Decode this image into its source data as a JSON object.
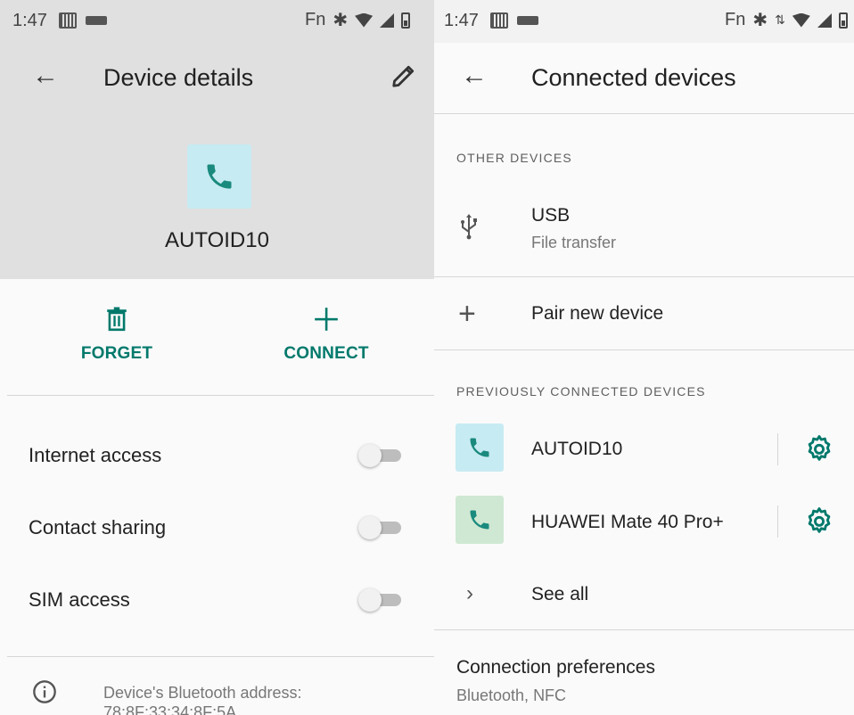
{
  "left_panel": {
    "status": {
      "time": "1:47",
      "volte": "VOLTE",
      "fn": "Fn"
    },
    "header": {
      "title": "Device details"
    },
    "device": {
      "name": "AUTOID10"
    },
    "actions": {
      "forget": "FORGET",
      "connect": "CONNECT"
    },
    "toggles": [
      {
        "label": "Internet access",
        "on": false
      },
      {
        "label": "Contact sharing",
        "on": false
      },
      {
        "label": "SIM access",
        "on": false
      }
    ],
    "bluetooth_address": {
      "label": "Device's Bluetooth address:",
      "value": "78:8F:33:34:8F:5A"
    }
  },
  "right_panel": {
    "status": {
      "time": "1:47",
      "volte": "VOLTE",
      "fn": "Fn"
    },
    "header": {
      "title": "Connected devices"
    },
    "other_devices": {
      "label": "OTHER DEVICES",
      "usb": {
        "title": "USB",
        "subtitle": "File transfer"
      }
    },
    "pair_new_device": "Pair new device",
    "previously_connected": {
      "label": "PREVIOUSLY CONNECTED DEVICES",
      "devices": [
        {
          "name": "AUTOID10",
          "tile_color": "#c7ebf2"
        },
        {
          "name": "HUAWEI Mate 40 Pro+",
          "tile_color": "#cfe8d3"
        }
      ]
    },
    "see_all": "See all",
    "connection_preferences": {
      "title": "Connection preferences",
      "subtitle": "Bluetooth, NFC"
    }
  },
  "colors": {
    "accent": "#00796b",
    "phone_icon": "#1a8a7e",
    "tile_blue": "#c7ebf2",
    "tile_green": "#cfe8d3"
  }
}
